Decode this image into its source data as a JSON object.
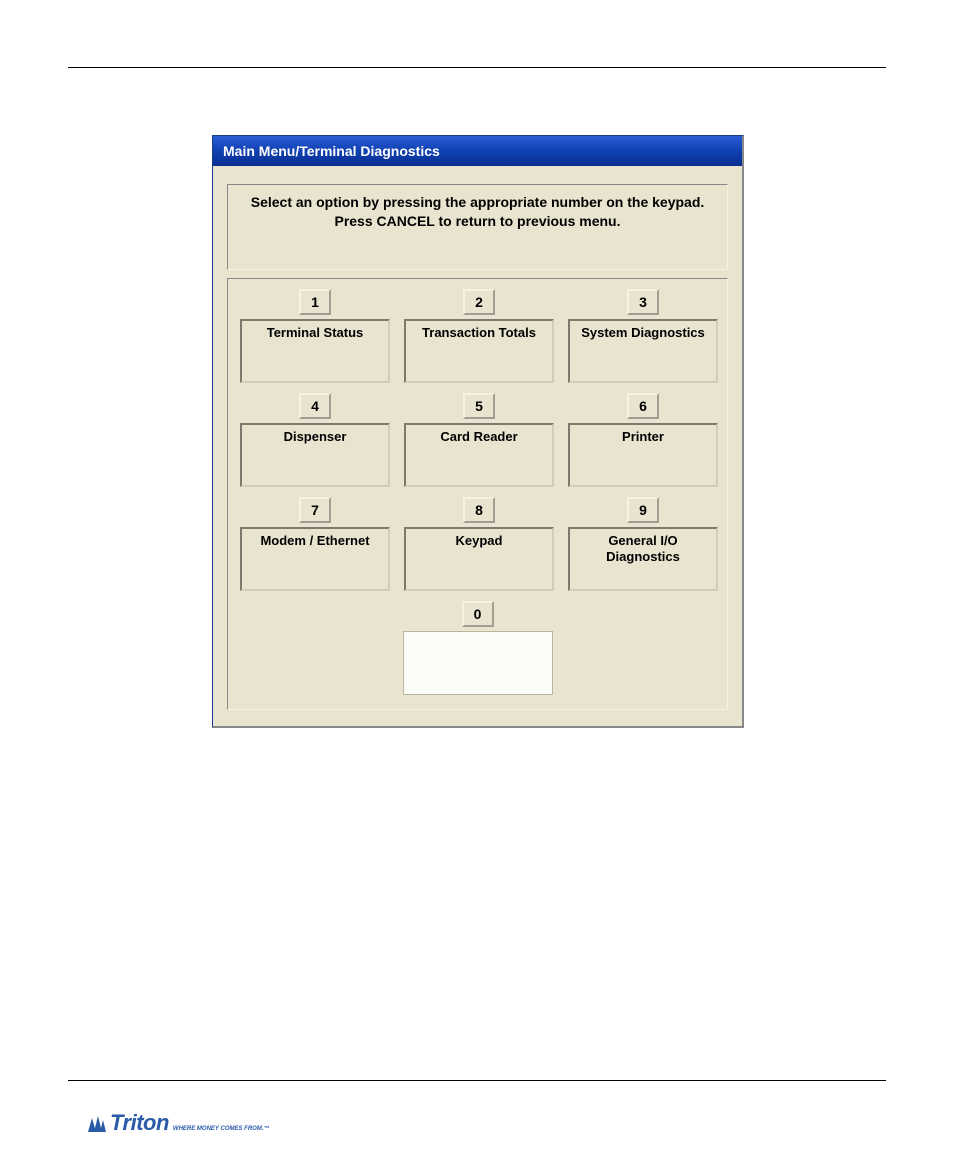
{
  "dialog": {
    "title": "Main Menu/Terminal Diagnostics",
    "instruction_line1": "Select an option by pressing the appropriate number on the keypad.",
    "instruction_line2": "Press CANCEL to return to previous menu.",
    "options": [
      {
        "num": "1",
        "label": "Terminal Status"
      },
      {
        "num": "2",
        "label": "Transaction Totals"
      },
      {
        "num": "3",
        "label": "System Diagnostics"
      },
      {
        "num": "4",
        "label": "Dispenser"
      },
      {
        "num": "5",
        "label": "Card Reader"
      },
      {
        "num": "6",
        "label": "Printer"
      },
      {
        "num": "7",
        "label": "Modem / Ethernet"
      },
      {
        "num": "8",
        "label": "Keypad"
      },
      {
        "num": "9",
        "label": "General I/O Diagnostics"
      },
      {
        "num": "0",
        "label": ""
      }
    ]
  },
  "footer": {
    "brand": "Triton",
    "tagline": "WHERE MONEY COMES FROM.™"
  }
}
